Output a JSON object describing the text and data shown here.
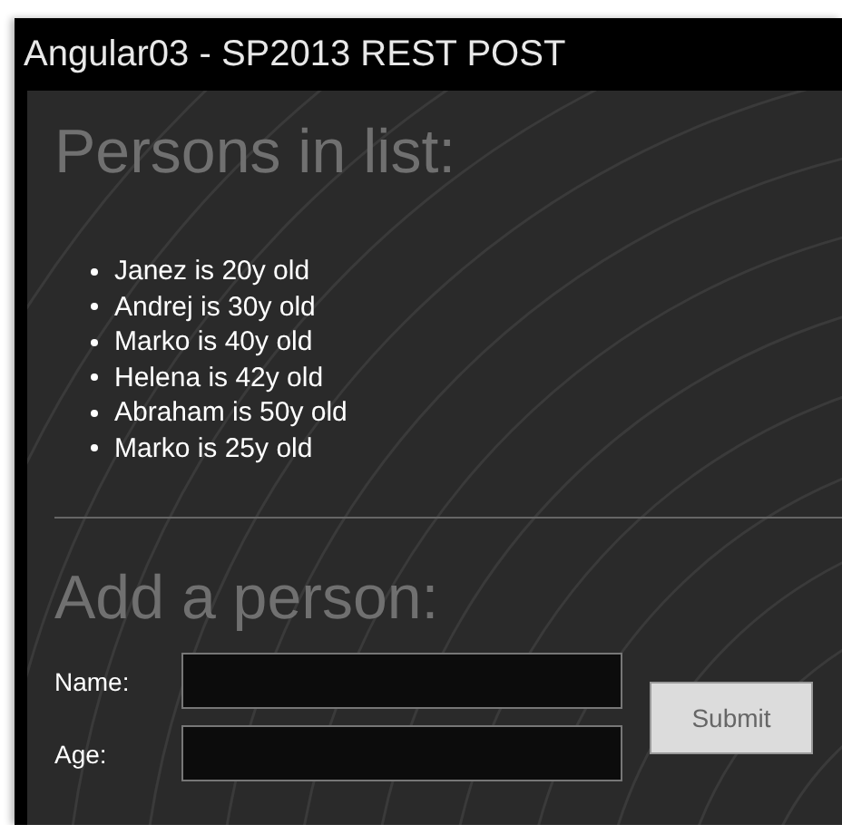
{
  "window": {
    "title": "Angular03 - SP2013 REST POST"
  },
  "list_section": {
    "heading": "Persons in list:",
    "items": [
      "Janez is 20y old",
      "Andrej is 30y old",
      "Marko is 40y old",
      "Helena is 42y old",
      "Abraham is 50y old",
      "Marko is 25y old"
    ]
  },
  "form": {
    "heading": "Add a person:",
    "fields": [
      {
        "label": "Name:"
      },
      {
        "label": "Age:"
      }
    ],
    "submit": "Submit"
  }
}
